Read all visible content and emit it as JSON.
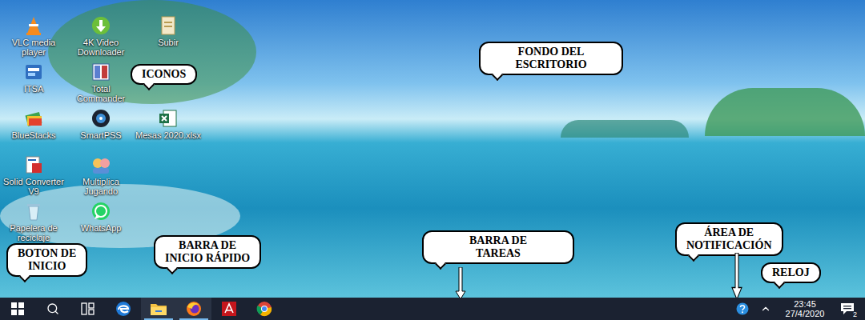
{
  "desktop": {
    "icon_rows": [
      [
        {
          "label": "VLC media player",
          "kind": "vlc"
        },
        {
          "label": "4K Video Downloader",
          "kind": "downloader"
        },
        {
          "label": "Subir",
          "kind": "doc"
        }
      ],
      [
        {
          "label": "ITSA",
          "kind": "itsa"
        },
        {
          "label": "Total Commander",
          "kind": "totalcmd"
        }
      ],
      [
        {
          "label": "BlueStacks",
          "kind": "bluestacks"
        },
        {
          "label": "SmartPSS",
          "kind": "smartpss"
        },
        {
          "label": "Mesas 2020.xlsx",
          "kind": "excel"
        }
      ],
      [
        {
          "label": "Solid Converter V9",
          "kind": "solid"
        },
        {
          "label": "Multiplica Jugando",
          "kind": "multiplica"
        }
      ],
      [
        {
          "label": "Papelera de reciclaje",
          "kind": "recycle"
        },
        {
          "label": "WhatsApp",
          "kind": "whatsapp"
        }
      ]
    ]
  },
  "callouts": {
    "icons": {
      "lines": [
        "ICONOS"
      ],
      "arrow": false
    },
    "wallpaper": {
      "lines": [
        "FONDO DEL",
        "ESCRITORIO"
      ],
      "arrow": false
    },
    "start": {
      "lines": [
        "BOTON DE",
        "INICIO"
      ],
      "arrow": false
    },
    "quick_launch": {
      "lines": [
        "BARRA DE",
        "INICIO RÁPIDO"
      ],
      "arrow": false
    },
    "taskbar": {
      "lines": [
        "BARRA DE",
        "TAREAS"
      ],
      "arrow": true
    },
    "notification_area": {
      "lines": [
        "ÁREA DE",
        "NOTIFICACIÓN"
      ],
      "arrow": true
    },
    "clock": {
      "lines": [
        "RELOJ"
      ],
      "arrow": false
    }
  },
  "taskbar": {
    "buttons": [
      {
        "kind": "start",
        "running": false
      },
      {
        "kind": "search",
        "running": false
      },
      {
        "kind": "taskview",
        "running": false
      },
      {
        "kind": "edge",
        "running": false
      },
      {
        "kind": "explorer",
        "running": true
      },
      {
        "kind": "firefox",
        "running": true
      },
      {
        "kind": "acrobat",
        "running": false
      },
      {
        "kind": "chrome",
        "running": false
      }
    ],
    "clock": {
      "time": "23:45",
      "date": "27/4/2020"
    },
    "notifications": {
      "count": "2"
    }
  }
}
